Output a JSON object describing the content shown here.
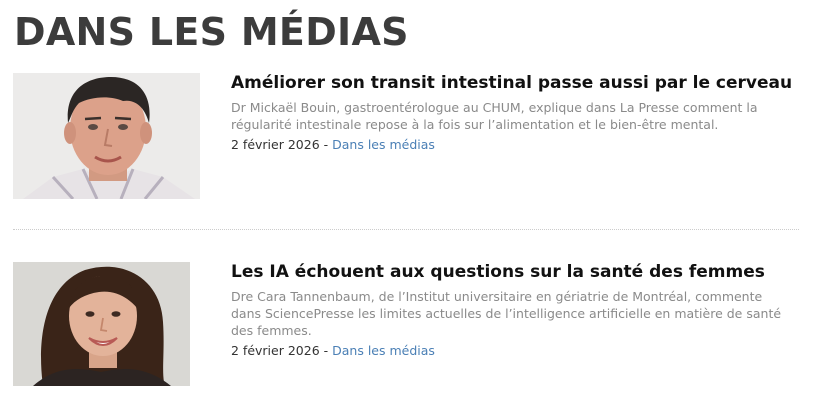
{
  "section": {
    "title": "DANS LES MÉDIAS"
  },
  "articles": [
    {
      "headline": "Améliorer son transit intestinal passe aussi par le cerveau",
      "summary": "Dr Mickaël Bouin, gastroentérologue au CHUM, explique dans La Presse comment la régularité intestinale repose à la fois sur l’alimentation et le bien-être mental.",
      "date": "2 février 2026",
      "separator": " - ",
      "category": "Dans les médias",
      "photo": "portrait-man-icon"
    },
    {
      "headline": "Les IA échouent aux questions sur la santé des femmes",
      "summary": "Dre Cara Tannenbaum, de l’Institut universitaire en gériatrie de Montréal, commente dans SciencePresse les limites actuelles de l’intelligence artificielle en matière de santé des femmes.",
      "date": "2 février 2026",
      "separator": " - ",
      "category": "Dans les médias",
      "photo": "portrait-woman-icon"
    }
  ],
  "colors": {
    "title": "#3c3c3c",
    "headline": "#111111",
    "summary": "#8a8a8a",
    "link": "#4a7fb5"
  }
}
